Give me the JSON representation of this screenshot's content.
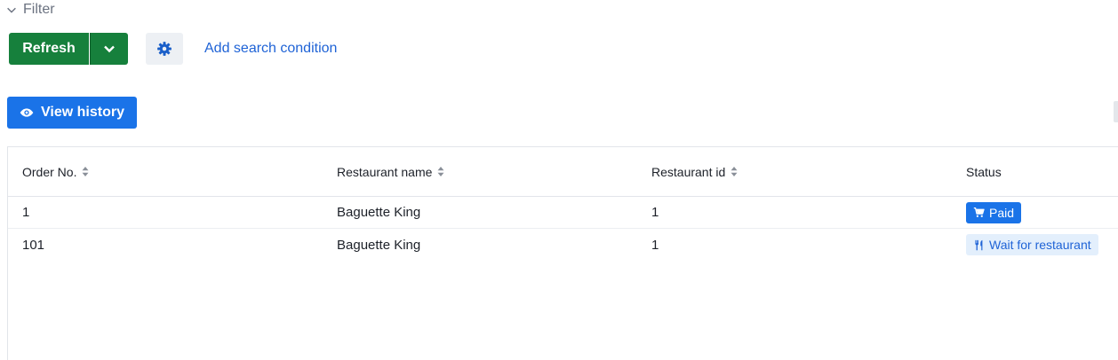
{
  "filter": {
    "label": "Filter"
  },
  "toolbar": {
    "refresh_label": "Refresh",
    "add_condition_label": "Add search condition"
  },
  "history_button": {
    "label": "View history"
  },
  "table": {
    "headers": [
      "Order No.",
      "Restaurant name",
      "Restaurant id",
      "Status"
    ],
    "rows": [
      {
        "order_no": "1",
        "restaurant_name": "Baguette King",
        "restaurant_id": "1",
        "status": "Paid",
        "status_icon": "cart-icon"
      },
      {
        "order_no": "101",
        "restaurant_name": "Baguette King",
        "restaurant_id": "1",
        "status": "Wait for restaurant",
        "status_icon": "utensils-icon"
      }
    ]
  },
  "colors": {
    "refresh": "#16803c",
    "primary": "#1a73e8",
    "link": "#1f63d6",
    "badge_light": "#e3effc"
  }
}
